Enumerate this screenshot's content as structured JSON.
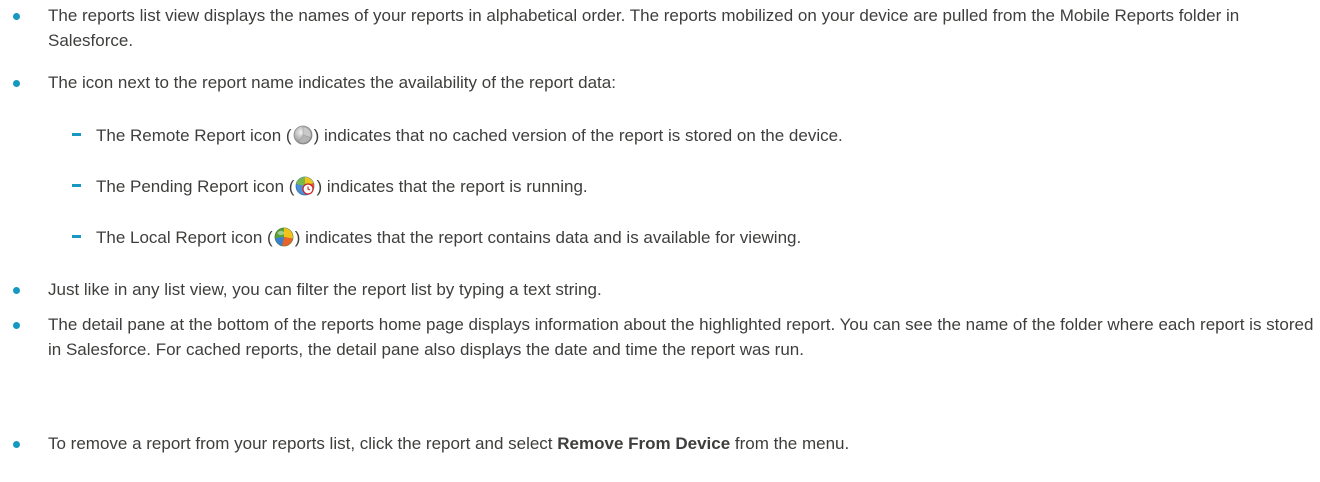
{
  "bullets": {
    "b1": "The reports list view displays the names of your reports in alphabetical order. The reports mobilized on your device are pulled from the Mobile Reports folder in Salesforce.",
    "b2": "The icon next to the report name indicates the availability of the report data:",
    "b3": "Just like in any list view, you can filter the report list by typing a text string.",
    "b4": "The detail pane at the bottom of the reports home page displays information about the highlighted report. You can see the name of the folder where each report is stored in Salesforce. For cached reports, the detail pane also displays the date and time the report was run.",
    "b5_before": "To remove a report from your reports list, click the report and select ",
    "b5_bold": "Remove From Device",
    "b5_after": " from the menu."
  },
  "sub_items": {
    "remote_before": "The Remote Report icon (",
    "remote_after": ") indicates that no cached version of the report is stored on the device.",
    "pending_before": "The Pending Report icon (",
    "pending_after": ") indicates that the report is running.",
    "local_before": "The Local Report icon (",
    "local_after": ") indicates that the report contains data and is available for viewing."
  },
  "colors": {
    "bullet": "#1798c1",
    "text": "#3e3e3c"
  },
  "icons": [
    "remote-report-icon",
    "pending-report-icon",
    "local-report-icon"
  ]
}
